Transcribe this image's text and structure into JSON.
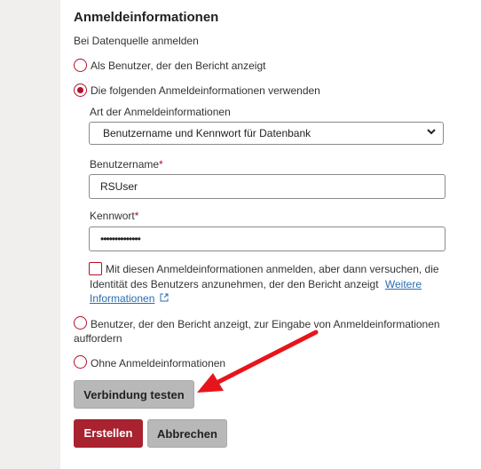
{
  "section": {
    "title": "Anmeldeinformationen",
    "subtitle": "Bei Datenquelle anmelden"
  },
  "options": {
    "as_user": "Als Benutzer, der den Bericht anzeigt",
    "use_following": "Die folgenden Anmeldeinformationen verwenden",
    "prompt_line1": "Benutzer, der den Bericht anzeigt, zur Eingabe von Anmeldeinformationen",
    "prompt_line2": "auffordern",
    "none": "Ohne Anmeldeinformationen"
  },
  "credential_type": {
    "label": "Art der Anmeldeinformationen",
    "value": "Benutzername und Kennwort für Datenbank"
  },
  "username": {
    "label": "Benutzername",
    "required_mark": "*",
    "value": "RSUser"
  },
  "password": {
    "label": "Kennwort",
    "required_mark": "*",
    "value": "••••••••••••••"
  },
  "impersonate": {
    "line1": "Mit diesen Anmeldeinformationen anmelden, aber dann versuchen, die",
    "line2": "Identität des Benutzers anzunehmen, der den Bericht anzeigt",
    "link_part1": "Weitere",
    "link_part2": "Informationen"
  },
  "buttons": {
    "test": "Verbindung testen",
    "create": "Erstellen",
    "cancel": "Abbrechen"
  },
  "colors": {
    "accent": "#b3102a",
    "primary_button": "#a8222f",
    "secondary_button": "#b8b8b8",
    "link": "#2b6cb0",
    "annotation_arrow": "#e8141c"
  }
}
